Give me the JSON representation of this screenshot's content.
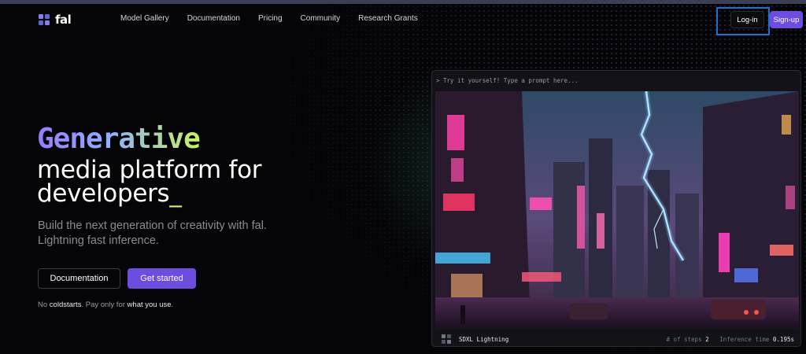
{
  "nav": {
    "logo_text": "fal",
    "items": [
      "Model Gallery",
      "Documentation",
      "Pricing",
      "Community",
      "Research Grants"
    ],
    "login_label": "Log-in",
    "signup_label": "Sign-up"
  },
  "hero": {
    "title_gradient": "Generative",
    "title_line2": "media platform for",
    "title_line3": "developers",
    "title_cursor": "_",
    "subtitle": "Build the next generation of creativity with fal. Lightning fast inference.",
    "documentation_button": "Documentation",
    "get_started_button": "Get started",
    "tagline": {
      "part1": "No ",
      "bold1": "coldstarts",
      "part2": ". Pay only for ",
      "bold2": "what you use",
      "part3": "."
    }
  },
  "demo": {
    "prompt_placeholder": "> Try it yourself! Type a prompt here...",
    "model_name": "SDXL Lightning",
    "steps_label": "# of steps",
    "steps_value": "2",
    "inference_label": "Inference time",
    "inference_value": "0.195s"
  },
  "colors": {
    "accent": "#6d4ce0",
    "highlight_box": "#1e6fd0",
    "gradient_start": "#9a7bff",
    "gradient_end": "#c9f35f"
  }
}
